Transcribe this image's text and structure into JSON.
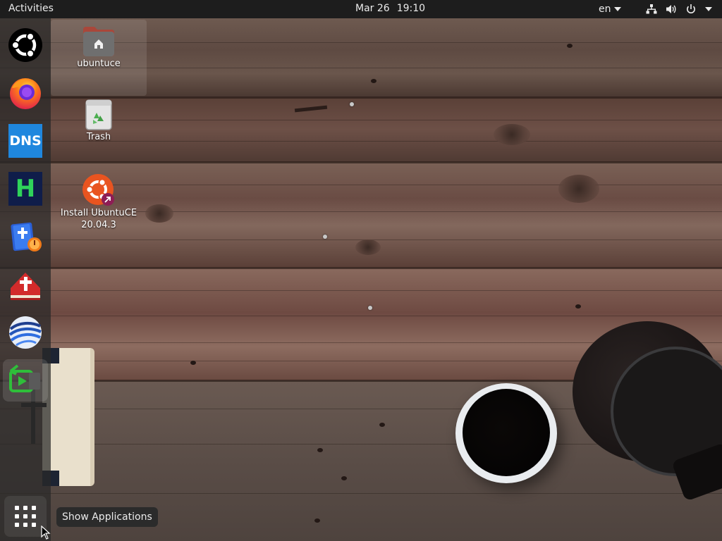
{
  "topbar": {
    "activities_label": "Activities",
    "date": "Mar 26",
    "time": "19:10",
    "language": "en"
  },
  "system_icons": [
    "network-icon",
    "volume-icon",
    "power-icon"
  ],
  "dock": {
    "items": [
      {
        "name": "ubuntu-logo-icon"
      },
      {
        "name": "firefox-icon"
      },
      {
        "name": "dns-icon",
        "label": "DNS"
      },
      {
        "name": "h-app-icon",
        "label": "H"
      },
      {
        "name": "bible-app-icon"
      },
      {
        "name": "red-bible-icon"
      },
      {
        "name": "globe-app-icon"
      },
      {
        "name": "screen-recorder-icon"
      }
    ]
  },
  "desktop": {
    "icons": [
      {
        "name": "home-folder",
        "label": "ubuntuce"
      },
      {
        "name": "trash",
        "label": "Trash"
      },
      {
        "name": "install-ubuntuce",
        "label_line1": "Install UbuntuCE",
        "label_line2": "20.04.3"
      }
    ]
  },
  "show_applications": {
    "tooltip": "Show Applications"
  },
  "colors": {
    "topbar": "#1d1d1d",
    "dock": "#282828",
    "ubuntu_orange": "#e95420"
  }
}
